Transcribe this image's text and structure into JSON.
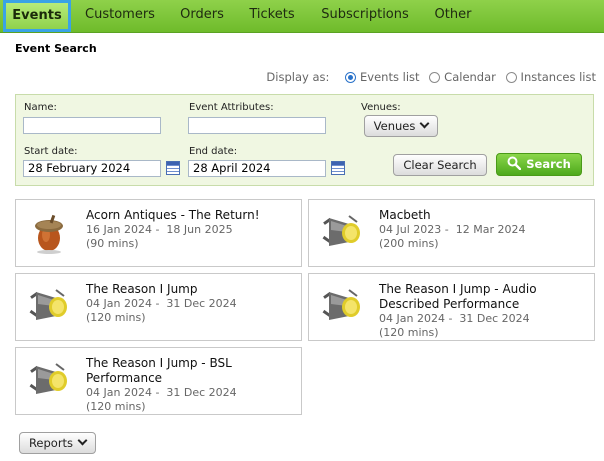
{
  "nav": {
    "tabs": [
      {
        "label": "Events",
        "active": true
      },
      {
        "label": "Customers"
      },
      {
        "label": "Orders"
      },
      {
        "label": "Tickets"
      },
      {
        "label": "Subscriptions"
      },
      {
        "label": "Other"
      }
    ]
  },
  "page_title": "Event Search",
  "display_as": {
    "label": "Display as:",
    "options": [
      {
        "label": "Events list",
        "selected": true
      },
      {
        "label": "Calendar"
      },
      {
        "label": "Instances list"
      }
    ]
  },
  "search": {
    "name_label": "Name:",
    "name_value": "",
    "attributes_label": "Event Attributes:",
    "attributes_value": "",
    "venues_label": "Venues:",
    "venues_select": "Venues",
    "start_label": "Start date:",
    "start_value": "28 February 2024",
    "end_label": "End date:",
    "end_value": "28 April 2024",
    "clear_label": "Clear Search",
    "search_label": "Search"
  },
  "events": [
    {
      "title": "Acorn Antiques - The Return!",
      "dates": "16 Jan 2024 -  18 Jun 2025",
      "duration": "(90 mins)",
      "icon": "acorn-icon"
    },
    {
      "title": "Macbeth",
      "dates": "04 Jul 2023 -  12 Mar 2024",
      "duration": "(200 mins)",
      "icon": "spotlight-icon"
    },
    {
      "title": "The Reason I Jump",
      "dates": "04 Jan 2024 -  31 Dec 2024",
      "duration": "(120 mins)",
      "icon": "spotlight-icon"
    },
    {
      "title": "The Reason I Jump - Audio Described Performance",
      "dates": "04 Jan 2024 -  31 Dec 2024",
      "duration": "(120 mins)",
      "icon": "spotlight-icon"
    },
    {
      "title": "The Reason I Jump - BSL Performance",
      "dates": "04 Jan 2024 -  31 Dec 2024",
      "duration": "(120 mins)",
      "icon": "spotlight-icon"
    }
  ],
  "reports_label": "Reports",
  "colors": {
    "nav_green": "#7cc63a",
    "active_outline": "#3aa3e6",
    "search_button": "#5cb526",
    "panel_bg": "#f0f7e2"
  }
}
